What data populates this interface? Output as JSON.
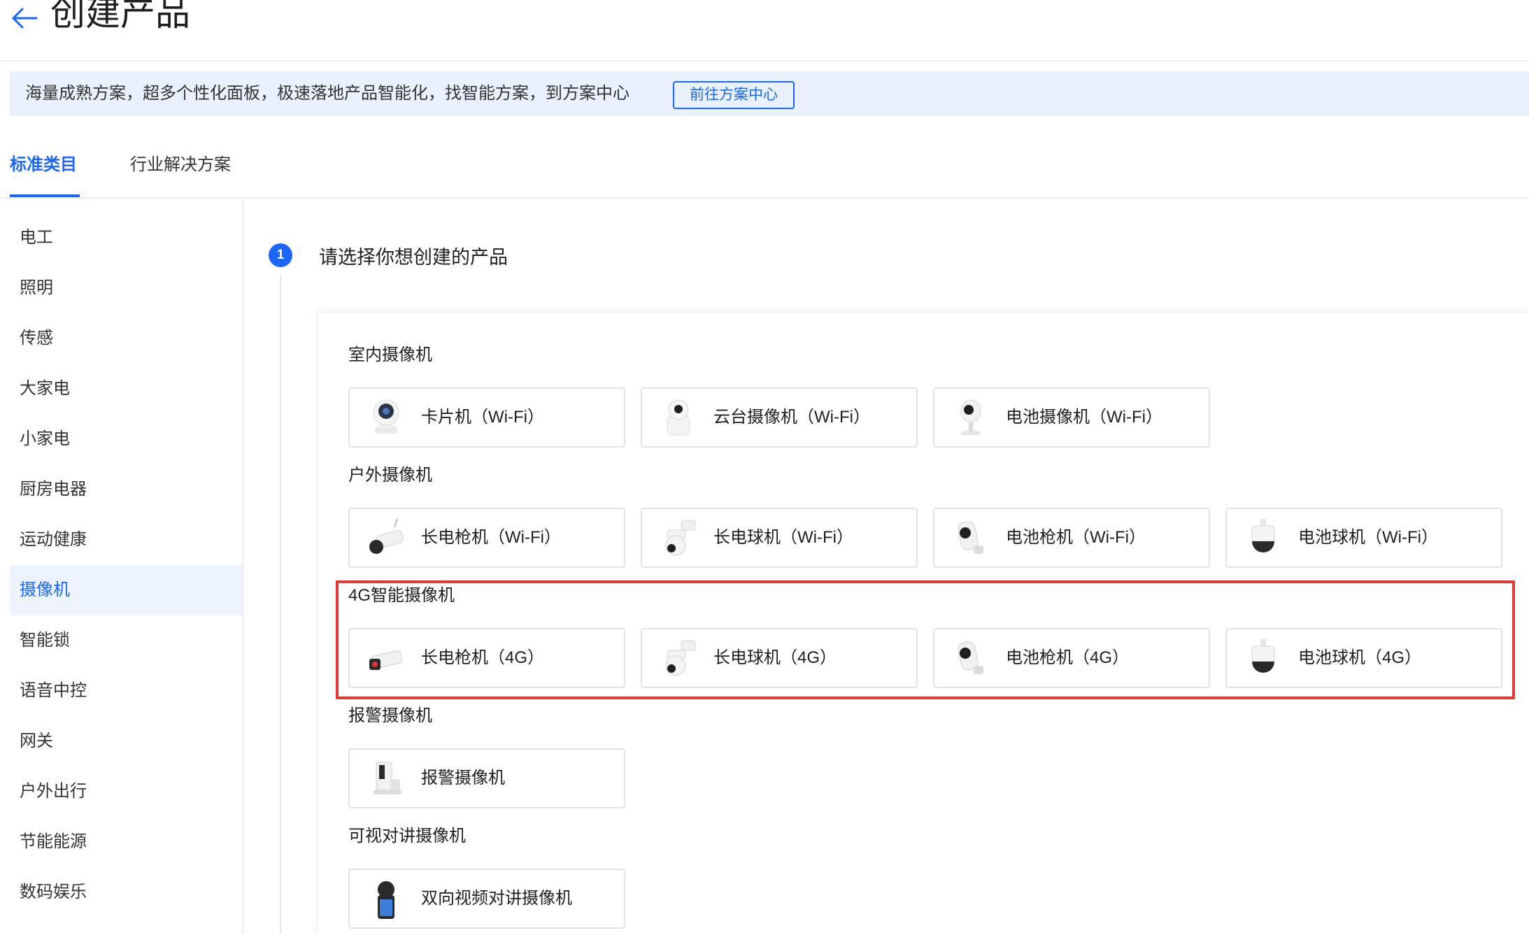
{
  "header": {
    "title": "创建产品"
  },
  "banner": {
    "text": "海量成熟方案，超多个性化面板，极速落地产品智能化，找智能方案，到方案中心",
    "button_label": "前往方案中心"
  },
  "tabs": [
    {
      "label": "标准类目",
      "active": true
    },
    {
      "label": "行业解决方案",
      "active": false
    }
  ],
  "sidebar": {
    "items": [
      {
        "label": "电工"
      },
      {
        "label": "照明"
      },
      {
        "label": "传感"
      },
      {
        "label": "大家电"
      },
      {
        "label": "小家电"
      },
      {
        "label": "厨房电器"
      },
      {
        "label": "运动健康"
      },
      {
        "label": "摄像机",
        "active": true
      },
      {
        "label": "智能锁"
      },
      {
        "label": "语音中控"
      },
      {
        "label": "网关"
      },
      {
        "label": "户外出行"
      },
      {
        "label": "节能能源"
      },
      {
        "label": "数码娱乐"
      }
    ]
  },
  "step": {
    "number": "1",
    "title": "请选择你想创建的产品"
  },
  "groups": [
    {
      "title": "室内摄像机",
      "products": [
        {
          "label": "卡片机（Wi-Fi）",
          "icon": "card-camera-icon"
        },
        {
          "label": "云台摄像机（Wi-Fi）",
          "icon": "ptz-camera-icon"
        },
        {
          "label": "电池摄像机（Wi-Fi）",
          "icon": "battery-camera-icon"
        }
      ]
    },
    {
      "title": "户外摄像机",
      "products": [
        {
          "label": "长电枪机（Wi-Fi）",
          "icon": "bullet-camera-icon"
        },
        {
          "label": "长电球机（Wi-Fi）",
          "icon": "dome-camera-icon"
        },
        {
          "label": "电池枪机（Wi-Fi）",
          "icon": "battery-bullet-camera-icon"
        },
        {
          "label": "电池球机（Wi-Fi）",
          "icon": "battery-dome-camera-icon"
        }
      ]
    },
    {
      "title": "4G智能摄像机",
      "highlighted": true,
      "products": [
        {
          "label": "长电枪机（4G）",
          "icon": "bullet-camera-icon"
        },
        {
          "label": "长电球机（4G）",
          "icon": "dome-camera-icon"
        },
        {
          "label": "电池枪机（4G）",
          "icon": "battery-bullet-camera-icon"
        },
        {
          "label": "电池球机（4G）",
          "icon": "battery-dome-camera-icon"
        }
      ]
    },
    {
      "title": "报警摄像机",
      "products": [
        {
          "label": "报警摄像机",
          "icon": "alarm-camera-icon"
        }
      ]
    },
    {
      "title": "可视对讲摄像机",
      "products": [
        {
          "label": "双向视频对讲摄像机",
          "icon": "video-intercom-camera-icon"
        }
      ]
    }
  ],
  "colors": {
    "accent": "#1a66ff",
    "banner_bg": "#e8f1fd",
    "highlight": "#e53935",
    "active_bg": "#eef4ff"
  }
}
